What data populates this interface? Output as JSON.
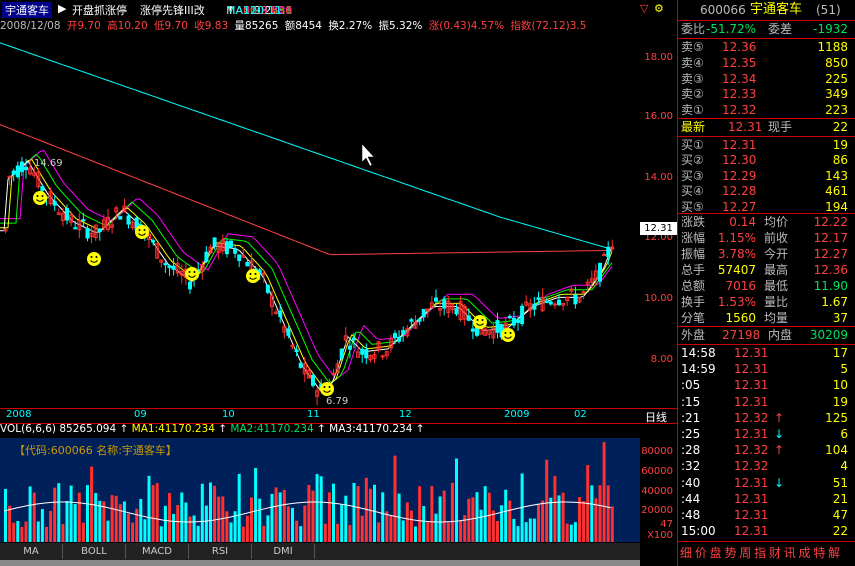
{
  "title": {
    "stock_name": "宇通客车",
    "tabs": [
      "开盘抓涨停",
      "涨停先锋III改"
    ],
    "ma_legend": [
      {
        "label": "MA5:9.258",
        "color": "#ffffff"
      },
      {
        "label": "MA10:8.736",
        "color": "#ffff00"
      },
      {
        "label": "MA21:8.531",
        "color": "#00ff00"
      },
      {
        "label": "MA30:8.209",
        "color": "#ff00ff"
      },
      {
        "label": "MA60:9.616",
        "color": "#ff4040"
      },
      {
        "label": "MA120:11.",
        "color": "#00ffff"
      }
    ]
  },
  "info": {
    "date": "2008/12/08",
    "open": "开9.70",
    "high": "高10.20",
    "low": "低9.70",
    "close": "收9.83",
    "volume": "量85265",
    "amount": "额8454",
    "turnover": "换2.27%",
    "amplitude": "振5.32%",
    "change": "涨(0.43)4.57%",
    "index": "指数(72.12)3.5"
  },
  "chart": {
    "price_ticks": [
      "18.00",
      "16.00",
      "14.00",
      "12.00",
      "10.00",
      "8.00"
    ],
    "current_price_tag": "12.31",
    "high_label": "14.69",
    "low_label": "6.79",
    "date_labels": [
      "2008",
      "09",
      "10",
      "11",
      "12",
      "2009",
      "02"
    ],
    "day_button": "日线"
  },
  "volume": {
    "legend": "VOL(6,6,6) 85265.094",
    "ma1": "MA1:41170.234",
    "ma2": "MA2:41170.234",
    "ma3": "MA3:41170.234",
    "code_box": "【代码:600066 名称:宇通客车】",
    "ticks": [
      "80000",
      "60000",
      "40000",
      "20000",
      "47",
      "X100"
    ]
  },
  "bottom_tabs": [
    "MA",
    "BOLL",
    "MACD",
    "RSI",
    "DMI"
  ],
  "quote": {
    "code": "600066",
    "name": "宇通客车",
    "number": "(51)",
    "webi_label": "委比",
    "webi_value": "-51.72%",
    "weicha_label": "委差",
    "weicha_value": "-1932",
    "sells": [
      {
        "label": "卖⑤",
        "price": "12.36",
        "vol": "1188"
      },
      {
        "label": "卖④",
        "price": "12.35",
        "vol": "850"
      },
      {
        "label": "卖③",
        "price": "12.34",
        "vol": "225"
      },
      {
        "label": "卖②",
        "price": "12.33",
        "vol": "349"
      },
      {
        "label": "卖①",
        "price": "12.32",
        "vol": "223"
      }
    ],
    "last_label": "最新",
    "last_value": "12.31",
    "hand_label": "现手",
    "hand_value": "22",
    "buys": [
      {
        "label": "买①",
        "price": "12.31",
        "vol": "19"
      },
      {
        "label": "买②",
        "price": "12.30",
        "vol": "86"
      },
      {
        "label": "买③",
        "price": "12.29",
        "vol": "143"
      },
      {
        "label": "买④",
        "price": "12.28",
        "vol": "461"
      },
      {
        "label": "买⑤",
        "price": "12.27",
        "vol": "194"
      }
    ],
    "stats": [
      {
        "l1": "涨跌",
        "v1": "0.14",
        "l2": "均价",
        "v2": "12.22"
      },
      {
        "l1": "涨幅",
        "v1": "1.15%",
        "l2": "前收",
        "v2": "12.17"
      },
      {
        "l1": "振幅",
        "v1": "3.78%",
        "l2": "今开",
        "v2": "12.27"
      },
      {
        "l1": "总手",
        "v1": "57407",
        "l2": "最高",
        "v2": "12.36"
      },
      {
        "l1": "总额",
        "v1": "7016",
        "l2": "最低",
        "v2": "11.90"
      },
      {
        "l1": "换手",
        "v1": "1.53%",
        "l2": "量比",
        "v2": "1.67"
      },
      {
        "l1": "分笔",
        "v1": "1560",
        "l2": "均量",
        "v2": "37"
      }
    ],
    "outer_label": "外盘",
    "outer_value": "27198",
    "inner_label": "内盘",
    "inner_value": "30209",
    "ticks": [
      {
        "time": "14:58",
        "price": "12.31",
        "vol": "17",
        "dir": ""
      },
      {
        "time": "14:59",
        "price": "12.31",
        "vol": "5",
        "dir": ""
      },
      {
        "time": ":05",
        "price": "12.31",
        "vol": "10",
        "dir": ""
      },
      {
        "time": ":15",
        "price": "12.31",
        "vol": "19",
        "dir": ""
      },
      {
        "time": ":21",
        "price": "12.32",
        "vol": "125",
        "dir": "↑"
      },
      {
        "time": ":25",
        "price": "12.31",
        "vol": "6",
        "dir": "↓"
      },
      {
        "time": ":28",
        "price": "12.32",
        "vol": "104",
        "dir": "↑"
      },
      {
        "time": ":32",
        "price": "12.32",
        "vol": "4",
        "dir": ""
      },
      {
        "time": ":40",
        "price": "12.31",
        "vol": "51",
        "dir": "↓"
      },
      {
        "time": ":44",
        "price": "12.31",
        "vol": "21",
        "dir": ""
      },
      {
        "time": ":48",
        "price": "12.31",
        "vol": "47",
        "dir": ""
      },
      {
        "time": "15:00",
        "price": "12.31",
        "vol": "22",
        "dir": ""
      }
    ],
    "footer_tabs": "细 价 盘 势 周 指 财 讯 成 特 解"
  }
}
